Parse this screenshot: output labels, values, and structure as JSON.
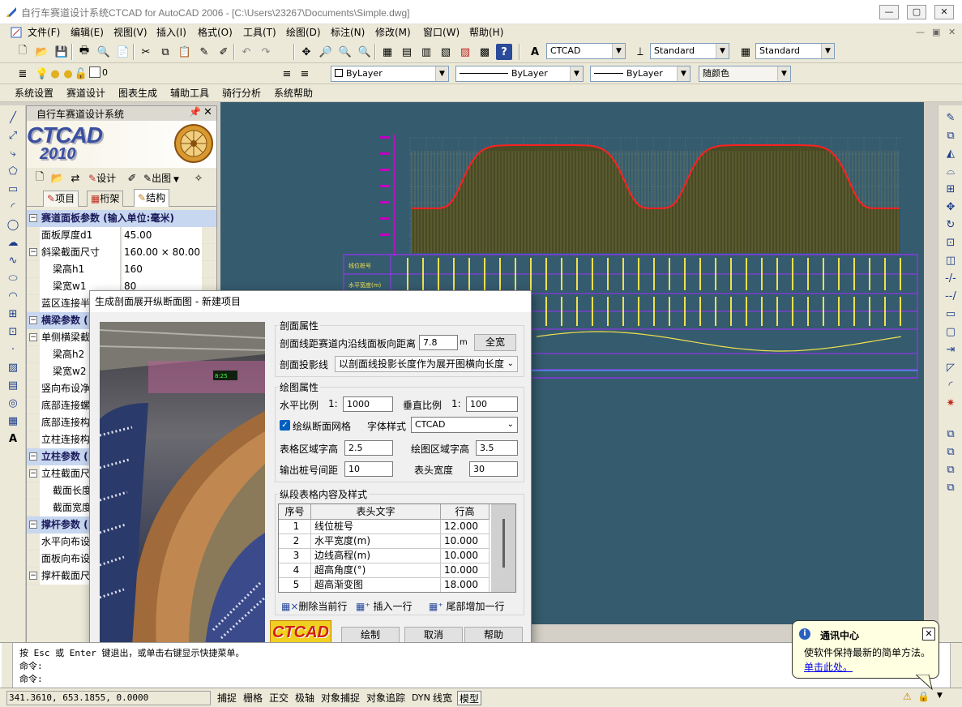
{
  "window": {
    "title": "自行车赛道设计系统CTCAD for AutoCAD 2006 - [C:\\Users\\23267\\Documents\\Simple.dwg]",
    "min_label": "—",
    "max_label": "▢",
    "close_label": "✕"
  },
  "menubar": {
    "items": [
      "文件(F)",
      "编辑(E)",
      "视图(V)",
      "插入(I)",
      "格式(O)",
      "工具(T)",
      "绘图(D)",
      "标注(N)",
      "修改(M)",
      "窗口(W)",
      "帮助(H)"
    ]
  },
  "toolbar": {
    "textstyle": "CTCAD",
    "dimstyle": "Standard",
    "tablestyle": "Standard",
    "layer": "0",
    "color": "ByLayer",
    "linetype": "ByLayer",
    "lineweight": "ByLayer",
    "plotstyle": "随颜色"
  },
  "appmenu": {
    "items": [
      "系统设置",
      "赛道设计",
      "图表生成",
      "辅助工具",
      "骑行分析",
      "系统帮助"
    ]
  },
  "sidepanel": {
    "title": "自行车赛道设计系统",
    "logo_text": "CTCAD",
    "logo_year": "2010",
    "tool_design": "设计",
    "tool_output": "出图",
    "tabs": [
      "项目",
      "桁架",
      "结构"
    ],
    "rows": [
      {
        "type": "cat",
        "label": "赛道面板参数 (输入单位:毫米)"
      },
      {
        "type": "row",
        "label": "面板厚度d1",
        "value": "45.00"
      },
      {
        "type": "sub",
        "label": "斜梁截面尺寸",
        "value": "160.00 × 80.00"
      },
      {
        "type": "row2",
        "label": "梁高h1",
        "value": "160"
      },
      {
        "type": "row2",
        "label": "梁宽w1",
        "value": "80"
      },
      {
        "type": "row",
        "label": "蓝区连接半",
        "value": ""
      },
      {
        "type": "cat",
        "label": "横梁参数 ("
      },
      {
        "type": "sub",
        "label": "单侧横梁截",
        "value": ""
      },
      {
        "type": "row2",
        "label": "梁高h2",
        "value": ""
      },
      {
        "type": "row2",
        "label": "梁宽w2",
        "value": ""
      },
      {
        "type": "row",
        "label": "竖向布设净",
        "value": ""
      },
      {
        "type": "row",
        "label": "底部连接螺",
        "value": ""
      },
      {
        "type": "row",
        "label": "底部连接构",
        "value": ""
      },
      {
        "type": "row",
        "label": "立柱连接构",
        "value": ""
      },
      {
        "type": "cat",
        "label": "立柱参数 ("
      },
      {
        "type": "sub",
        "label": "立柱截面尺",
        "value": ""
      },
      {
        "type": "row2",
        "label": "截面长度",
        "value": ""
      },
      {
        "type": "row2",
        "label": "截面宽度",
        "value": ""
      },
      {
        "type": "cat",
        "label": "撑杆参数 ("
      },
      {
        "type": "row",
        "label": "水平向布设",
        "value": ""
      },
      {
        "type": "row",
        "label": "面板向布设",
        "value": ""
      },
      {
        "type": "sub",
        "label": "撑杆截面尺",
        "value": ""
      }
    ]
  },
  "drawing": {
    "table_headers": [
      "线位桩号",
      "水平宽度(m)"
    ]
  },
  "dialog": {
    "title": "生成剖面展开纵断面图 - 新建项目",
    "section1": "剖面属性",
    "dist_label": "剖面线距赛道内沿线面板向距离",
    "dist_value": "7.8",
    "dist_unit": "m",
    "fullwidth_btn": "全宽",
    "proj_label": "剖面投影线",
    "proj_value": "以剖面线投影长度作为展开图横向长度",
    "section2": "绘图属性",
    "hscale_label": "水平比例",
    "hscale_prefix": "1:",
    "hscale_value": "1000",
    "vscale_label": "垂直比例",
    "vscale_prefix": "1:",
    "vscale_value": "100",
    "grid_check_label": "绘纵断面网格",
    "grid_checked": true,
    "font_label": "字体样式",
    "font_value": "CTCAD",
    "table_h_label": "表格区域字高",
    "table_h_value": "2.5",
    "draw_h_label": "绘图区域字高",
    "draw_h_value": "3.5",
    "pile_label": "输出桩号间距",
    "pile_value": "10",
    "header_w_label": "表头宽度",
    "header_w_value": "30",
    "section3": "纵段表格内容及样式",
    "grid_headers": [
      "序号",
      "表头文字",
      "行高"
    ],
    "grid_rows": [
      {
        "no": "1",
        "text": "线位桩号",
        "height": "12.000"
      },
      {
        "no": "2",
        "text": "水平宽度(m)",
        "height": "10.000"
      },
      {
        "no": "3",
        "text": "边线高程(m)",
        "height": "10.000"
      },
      {
        "no": "4",
        "text": "超高角度(°)",
        "height": "10.000"
      },
      {
        "no": "5",
        "text": "超高渐变图",
        "height": "18.000"
      }
    ],
    "del_row": "删除当前行",
    "insert_row": "插入一行",
    "append_row": "尾部增加一行",
    "logo": "CTCAD",
    "draw_btn": "绘制",
    "cancel_btn": "取消",
    "help_btn": "帮助"
  },
  "command": {
    "line1": "按 Esc 或 Enter 键退出，或单击右键显示快捷菜单。",
    "line2": "命令:",
    "line3": "命令:"
  },
  "status": {
    "coords": "341.3610, 653.1855, 0.0000",
    "buttons": [
      "捕捉",
      "栅格",
      "正交",
      "极轴",
      "对象捕捉",
      "对象追踪",
      "DYN",
      "线宽",
      "模型"
    ]
  },
  "balloon": {
    "title": "通讯中心",
    "text": "使软件保持最新的简单方法。",
    "link": "单击此处。"
  },
  "colors": {
    "drawing_bg": "#355b6e",
    "profile_line": "#ff2020",
    "profile_fill": "#4a4a25",
    "table_lines": "#9b30ff",
    "text_yellow": "#f0e050"
  }
}
